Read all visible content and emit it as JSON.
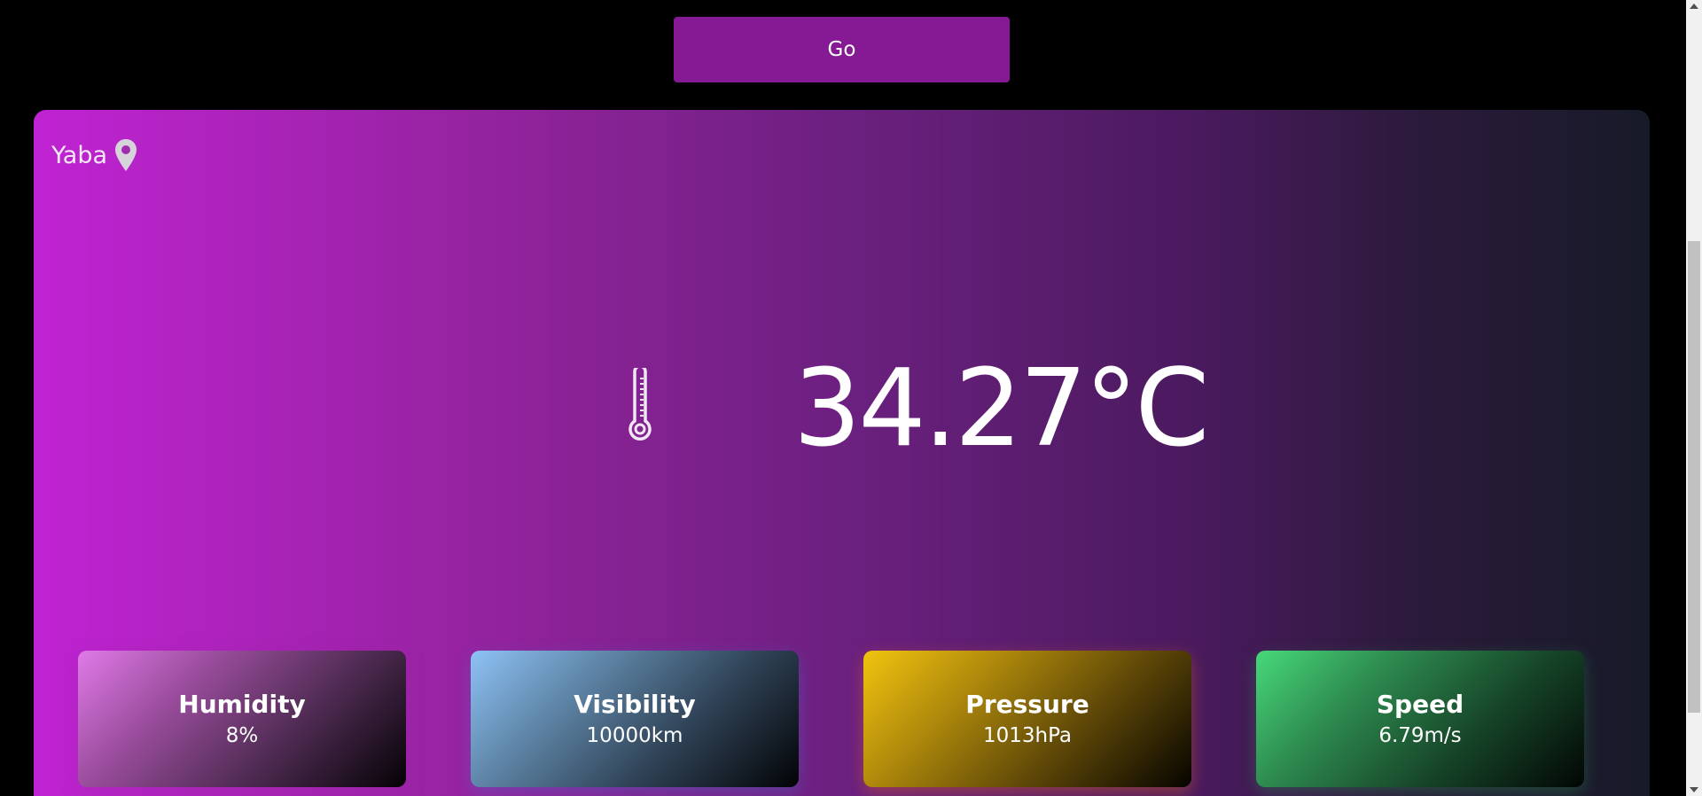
{
  "search": {
    "go_label": "Go"
  },
  "weather": {
    "location": "Yaba",
    "temperature": "34.27°C"
  },
  "metrics": [
    {
      "title": "Humidity",
      "value": "8%"
    },
    {
      "title": "Visibility",
      "value": "10000km"
    },
    {
      "title": "Pressure",
      "value": "1013hPa"
    },
    {
      "title": "Speed",
      "value": "6.79m/s"
    }
  ],
  "icons": {
    "location": "map-pin-icon",
    "temperature": "thermometer-icon"
  },
  "colors": {
    "go_button": "#861a95",
    "card_gradient_start": "#c023d3",
    "card_gradient_end": "#171a28",
    "humidity_accent": "#e07ae8",
    "visibility_accent": "#8ec2f6",
    "pressure_accent": "#f1c40f",
    "speed_accent": "#48d97a"
  }
}
